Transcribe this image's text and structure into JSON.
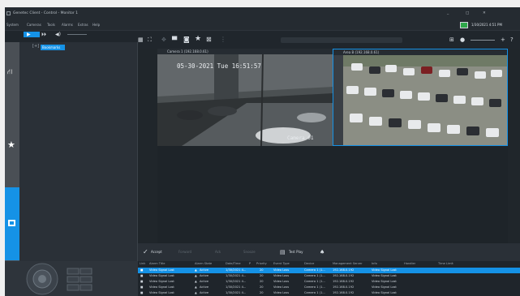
{
  "window": {
    "title": "Genetec Client - Control - Monitor 1",
    "clock": "1/30/2021 4:51 PM",
    "colors": {
      "accent": "#1592e6",
      "bg": "#1c2127",
      "panel": "#2a3037"
    }
  },
  "menu": [
    "System",
    "Cameras",
    "Tools",
    "Alarms",
    "Extras",
    "Help"
  ],
  "tree": {
    "item": "Bookmarks"
  },
  "cameras": [
    {
      "title": "Camera 1 (192.168.0.61)",
      "overlay_datetime": "05-30-2021 Tue 16:51:57",
      "overlay_name": "Camera 01"
    },
    {
      "title": "Area B (192.168.0.61)"
    }
  ],
  "actions": {
    "accept": "Accept",
    "forward": "Forward",
    "ack": "Ack",
    "snooze": "Snooze",
    "test": "Test Play"
  },
  "alarm_table": {
    "headers": [
      "Link",
      "Alarm Title",
      "Alarm State",
      "Date/Time",
      "P",
      "Priority",
      "Event Type",
      "Device",
      "Management Server",
      "Info",
      "Handler",
      "Time Limit"
    ],
    "rows": [
      [
        "Video Signal Lost",
        "Active",
        "1/30/2021 4...",
        "20",
        "Video Loss",
        "Camera 1 (1...",
        "192.168.0.192",
        "Video Signal Lost"
      ],
      [
        "Video Signal Lost",
        "Active",
        "1/30/2021 4...",
        "20",
        "Video Loss",
        "Camera 1 (1...",
        "192.168.0.192",
        "Video Signal Lost"
      ],
      [
        "Video Signal Lost",
        "Active",
        "1/30/2021 4...",
        "20",
        "Video Loss",
        "Camera 1 (1...",
        "192.168.0.192",
        "Video Signal Lost"
      ],
      [
        "Video Signal Lost",
        "Active",
        "1/30/2021 4...",
        "20",
        "Video Loss",
        "Camera 1 (1...",
        "192.168.0.192",
        "Video Signal Lost"
      ],
      [
        "Video Signal Lost",
        "Active",
        "1/30/2021 4...",
        "20",
        "Video Loss",
        "Camera 1 (1...",
        "192.168.0.192",
        "Video Signal Lost"
      ]
    ]
  }
}
